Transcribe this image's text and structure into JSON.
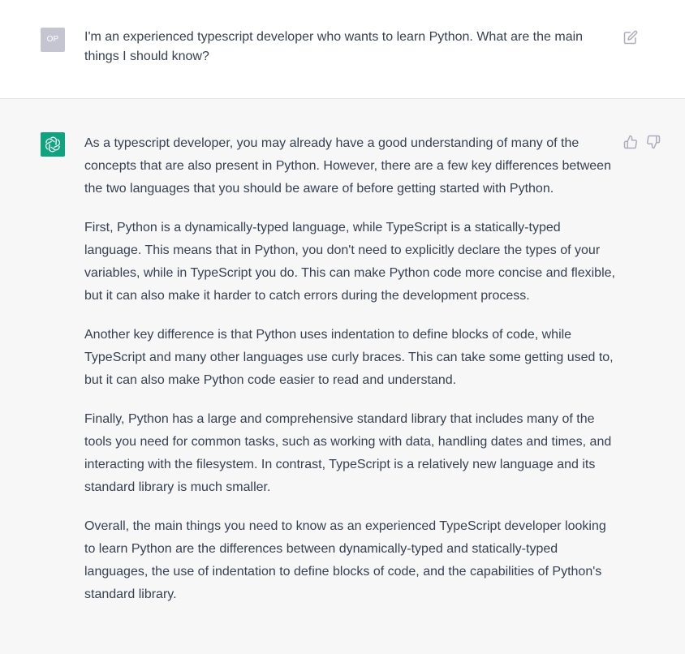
{
  "colors": {
    "assistant_bg": "#f7f7f8",
    "user_bg": "#ffffff",
    "brand_green": "#10a37f",
    "user_avatar_bg": "#c5c5d2",
    "text": "#374151",
    "icon_gray": "#acacbe"
  },
  "user_message": {
    "avatar_initials": "OP",
    "text": "I'm an experienced typescript developer who wants to learn Python. What are the main things I should know?",
    "edit_icon": "edit-icon"
  },
  "assistant_message": {
    "avatar_icon": "openai-logo-icon",
    "paragraphs": [
      "As a typescript developer, you may already have a good understanding of many of the concepts that are also present in Python. However, there are a few key differences between the two languages that you should be aware of before getting started with Python.",
      "First, Python is a dynamically-typed language, while TypeScript is a statically-typed language. This means that in Python, you don't need to explicitly declare the types of your variables, while in TypeScript you do. This can make Python code more concise and flexible, but it can also make it harder to catch errors during the development process.",
      "Another key difference is that Python uses indentation to define blocks of code, while TypeScript and many other languages use curly braces. This can take some getting used to, but it can also make Python code easier to read and understand.",
      "Finally, Python has a large and comprehensive standard library that includes many of the tools you need for common tasks, such as working with data, handling dates and times, and interacting with the filesystem. In contrast, TypeScript is a relatively new language and its standard library is much smaller.",
      "Overall, the main things you need to know as an experienced TypeScript developer looking to learn Python are the differences between dynamically-typed and statically-typed languages, the use of indentation to define blocks of code, and the capabilities of Python's standard library."
    ],
    "feedback_icons": [
      "thumbs-up-icon",
      "thumbs-down-icon"
    ]
  }
}
